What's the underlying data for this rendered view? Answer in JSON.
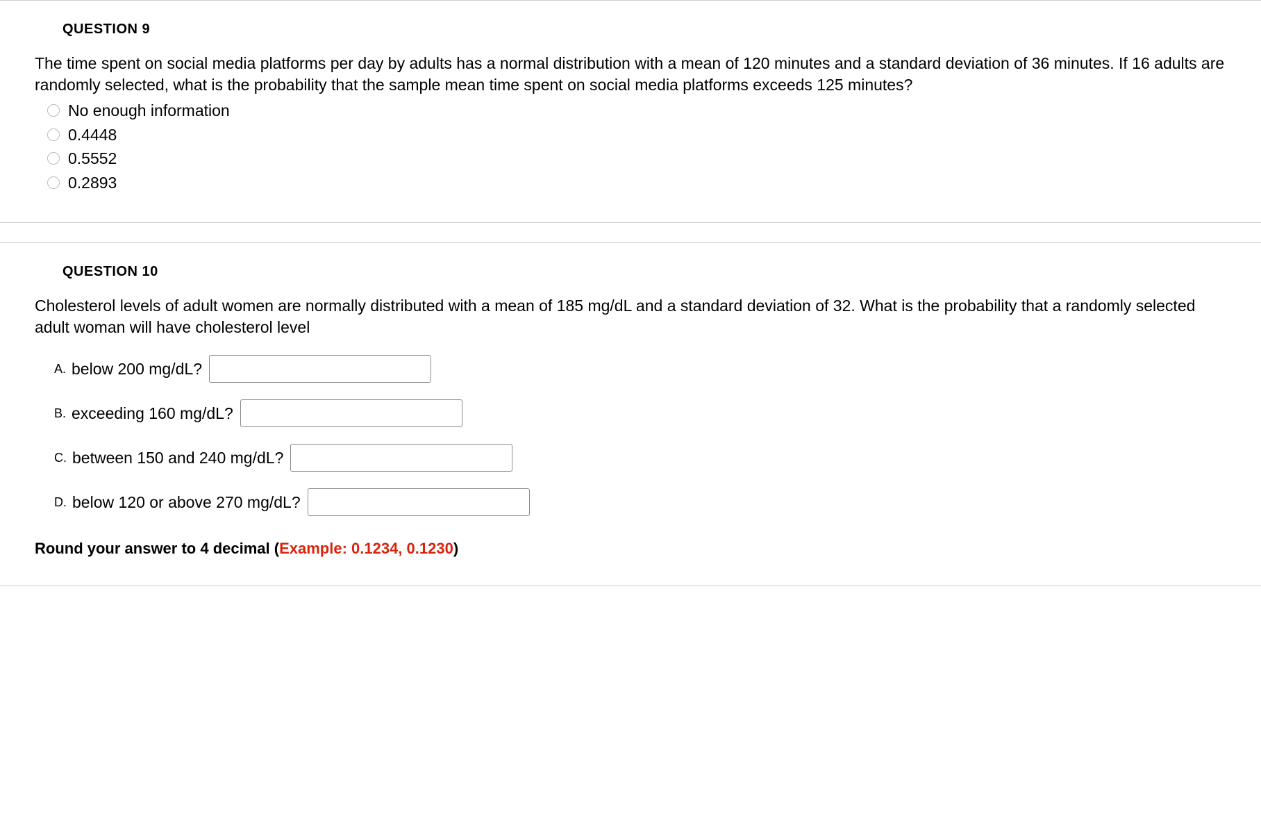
{
  "question9": {
    "header": "QUESTION 9",
    "text": "The time spent on social media platforms per day by adults has a normal distribution with a mean of 120 minutes and a standard deviation of 36 minutes. If 16 adults are randomly selected, what is the probability that the sample mean time spent on social media platforms exceeds 125 minutes?",
    "options": [
      "No enough information",
      "0.4448",
      "0.5552",
      "0.2893"
    ]
  },
  "question10": {
    "header": "QUESTION 10",
    "text": "Cholesterol levels of adult women are normally distributed with a mean of 185 mg/dL and a standard deviation of 32. What is the probability that a randomly selected adult woman will have cholesterol level",
    "subquestions": [
      {
        "letter": "A.",
        "label": "below 200 mg/dL?"
      },
      {
        "letter": "B.",
        "label": "exceeding 160 mg/dL?"
      },
      {
        "letter": "C.",
        "label": "between 150 and 240 mg/dL?"
      },
      {
        "letter": "D.",
        "label": "below 120 or above 270 mg/dL?"
      }
    ],
    "roundingPrefix": "Round your answer to 4 decimal (",
    "roundingExample": "Example: 0.1234, 0.1230",
    "roundingSuffix": ")"
  }
}
